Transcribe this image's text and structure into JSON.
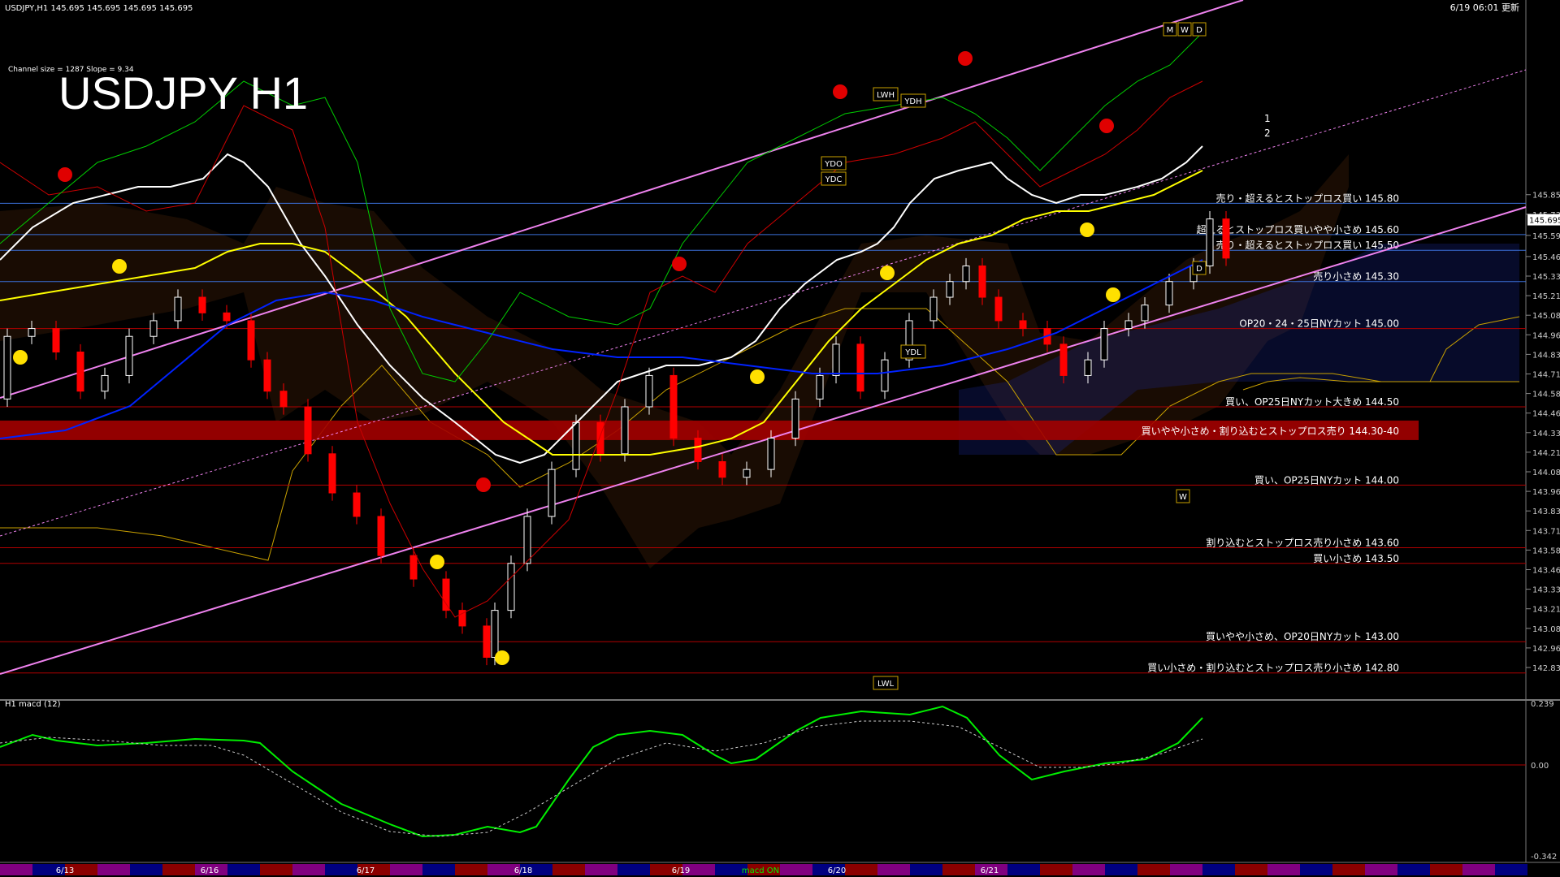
{
  "window": {
    "header_info": "USDJPY,H1  145.695 145.695 145.695 145.695",
    "timestamp": "6/19 06:01 更新",
    "title": "USDJPY H1",
    "channel_info": "Channel size = 1287 Slope = 9.34"
  },
  "colors": {
    "background": "#000000",
    "bull_candle": "#ffffff",
    "bear_candle": "#ff0000",
    "ma_short": "#ffffff",
    "ma_mid": "#ffff00",
    "ma_long": "#0000ff",
    "channel": "#ee82ee",
    "level_red": "#cc0000",
    "level_blue": "#3366ff",
    "macd_up": "#00ee00",
    "macd_down": "#ff99cc",
    "signal": "#cccccc",
    "date_bar": [
      "#800080",
      "#000080",
      "#8b0000"
    ]
  },
  "chart_data": {
    "type": "candlestick",
    "symbol": "USDJPY",
    "timeframe": "H1",
    "ylim": [
      142.75,
      145.9
    ],
    "y_ticks": [
      "145.855",
      "145.730",
      "145.595",
      "145.460",
      "145.335",
      "145.210",
      "145.085",
      "144.960",
      "144.835",
      "144.710",
      "144.585",
      "144.460",
      "144.335",
      "144.210",
      "144.085",
      "143.960",
      "143.835",
      "143.710",
      "143.585",
      "143.460",
      "143.335",
      "143.210",
      "143.085",
      "142.960",
      "142.835"
    ],
    "current_price": "145.695",
    "date_labels": [
      "6/13",
      "6/16",
      "6/17",
      "6/18",
      "6/19",
      "6/20",
      "6/21"
    ],
    "macd_label": "macd ON",
    "levels": [
      {
        "price": 145.8,
        "text": "売り・超えるとストップロス買い 145.80",
        "color": "blue"
      },
      {
        "price": 145.6,
        "text": "超えるとストップロス買いやや小さめ 145.60",
        "color": "blue"
      },
      {
        "price": 145.5,
        "text": "売り・超えるとストップロス買い 145.50",
        "color": "blue"
      },
      {
        "price": 145.3,
        "text": "売り小さめ 145.30",
        "color": "blue"
      },
      {
        "price": 145.0,
        "text": "OP20・24・25日NYカット 145.00",
        "color": "red"
      },
      {
        "price": 144.5,
        "text": "買い、OP25日NYカット大きめ 144.50",
        "color": "red"
      },
      {
        "price": 144.35,
        "text": "買いやや小さめ・割り込むとストップロス売り 144.30-40",
        "color": "band"
      },
      {
        "price": 144.0,
        "text": "買い、OP25日NYカット 144.00",
        "color": "red"
      },
      {
        "price": 143.6,
        "text": "割り込むとストップロス売り小さめ 143.60",
        "color": "red"
      },
      {
        "price": 143.5,
        "text": "買い小さめ 143.50",
        "color": "red"
      },
      {
        "price": 143.0,
        "text": "買いやや小さめ、OP20日NYカット 143.00",
        "color": "red"
      },
      {
        "price": 142.8,
        "text": "買い小さめ・割り込むとストップロス売り小さめ 142.80",
        "color": "red"
      }
    ],
    "markers": [
      "LWH",
      "YDH",
      "YDO",
      "YDC",
      "YDL",
      "LWL",
      "D",
      "W",
      "M",
      "W",
      "D"
    ],
    "channel_numbers": [
      "1",
      "2"
    ],
    "macd": {
      "title": "H1 macd (12)",
      "ylim": [
        -0.342,
        0.239
      ],
      "ticks": [
        "0.239",
        "0.00",
        "-0.342"
      ]
    }
  }
}
